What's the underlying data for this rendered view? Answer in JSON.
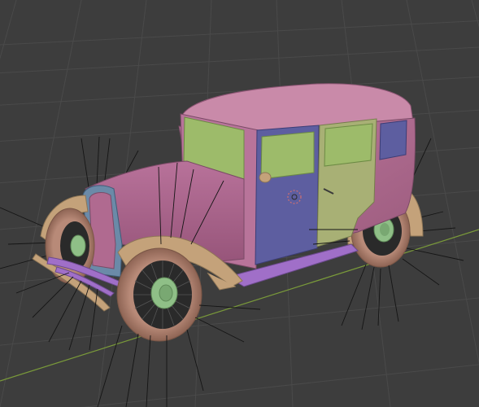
{
  "viewport": {
    "background": "#3d3d3d",
    "grid_color": "#484848",
    "x_axis_color": "#9a4c4c",
    "y_axis_color": "#7a9a3a"
  },
  "model": {
    "body_color": "#b06a90",
    "fender_color": "#c4a27a",
    "hood_trim_color": "#6b8aa8",
    "window_green_color": "#9dbb6a",
    "door_blue_color": "#5d5ea0",
    "rear_door_color": "#a8b075",
    "hub_color": "#8fbf87",
    "running_board_color": "#a06fc8",
    "spoke_line_color": "#1a1a1a"
  }
}
